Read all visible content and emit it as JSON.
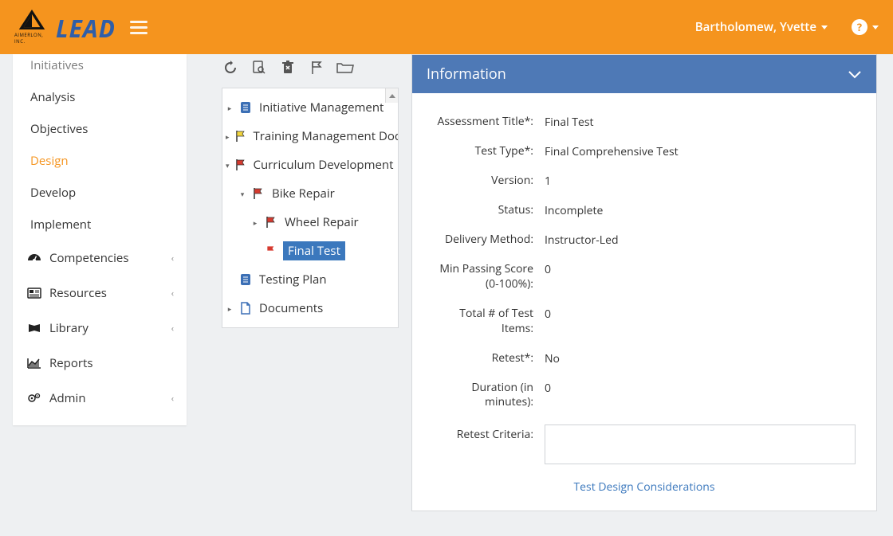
{
  "header": {
    "product": "LEAD",
    "company": "AIMERLON, INC.",
    "user": "Bartholomew, Yvette"
  },
  "sidebar": {
    "items": [
      {
        "label": "Initiatives",
        "active": false
      },
      {
        "label": "Analysis",
        "active": false
      },
      {
        "label": "Objectives",
        "active": false
      },
      {
        "label": "Design",
        "active": true
      },
      {
        "label": "Develop",
        "active": false
      },
      {
        "label": "Implement",
        "active": false
      }
    ],
    "sections": [
      {
        "label": "Competencies",
        "icon": "gauge"
      },
      {
        "label": "Resources",
        "icon": "news"
      },
      {
        "label": "Library",
        "icon": "book"
      },
      {
        "label": "Reports",
        "icon": "chart"
      },
      {
        "label": "Admin",
        "icon": "gears"
      }
    ]
  },
  "tree": {
    "nodes": {
      "initiative": "Initiative Management",
      "training_doc": "Training Management Doc",
      "curriculum": "Curriculum Development",
      "bike": "Bike Repair",
      "wheel": "Wheel Repair",
      "final": "Final Test",
      "testing_plan": "Testing Plan",
      "documents": "Documents"
    }
  },
  "info_panel": {
    "title": "Information",
    "rows": {
      "assessment_title": {
        "label": "Assessment Title*:",
        "value": "Final Test"
      },
      "test_type": {
        "label": "Test Type*:",
        "value": "Final Comprehensive Test"
      },
      "version": {
        "label": "Version:",
        "value": "1"
      },
      "status": {
        "label": "Status:",
        "value": "Incomplete"
      },
      "delivery": {
        "label": "Delivery Method:",
        "value": "Instructor-Led"
      },
      "min_score": {
        "label": "Min Passing Score (0-100%):",
        "value": "0"
      },
      "total_items": {
        "label": "Total # of Test Items:",
        "value": "0"
      },
      "retest": {
        "label": "Retest*:",
        "value": "No"
      },
      "duration": {
        "label": "Duration (in minutes):",
        "value": "0"
      },
      "retest_criteria": {
        "label": "Retest Criteria:",
        "value": ""
      }
    },
    "footer_link": "Test Design Considerations"
  }
}
